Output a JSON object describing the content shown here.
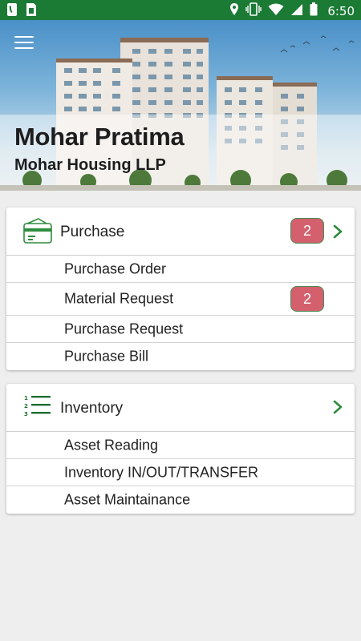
{
  "status_bar": {
    "time": "6:50",
    "left_icons": [
      "phone-icon",
      "sim-card-icon"
    ],
    "right_icons": [
      "location-icon",
      "vibrate-icon",
      "wifi-icon",
      "signal-icon",
      "battery-icon"
    ]
  },
  "header": {
    "project_name": "Mohar Pratima",
    "company_name": "Mohar Housing LLP"
  },
  "sections": [
    {
      "label": "Purchase",
      "badge": "2",
      "icon": "card-icon",
      "items": [
        {
          "label": "Purchase Order",
          "badge": ""
        },
        {
          "label": "Material Request",
          "badge": "2"
        },
        {
          "label": "Purchase Request",
          "badge": ""
        },
        {
          "label": "Purchase Bill",
          "badge": ""
        }
      ]
    },
    {
      "label": "Inventory",
      "badge": "",
      "icon": "numbered-list-icon",
      "items": [
        {
          "label": "Asset Reading"
        },
        {
          "label": "Inventory IN/OUT/TRANSFER"
        },
        {
          "label": "Asset Maintainance"
        }
      ]
    }
  ],
  "colors": {
    "status_bar": "#1b7a34",
    "accent_green": "#2e8b3e",
    "badge_red": "#d4606e"
  }
}
